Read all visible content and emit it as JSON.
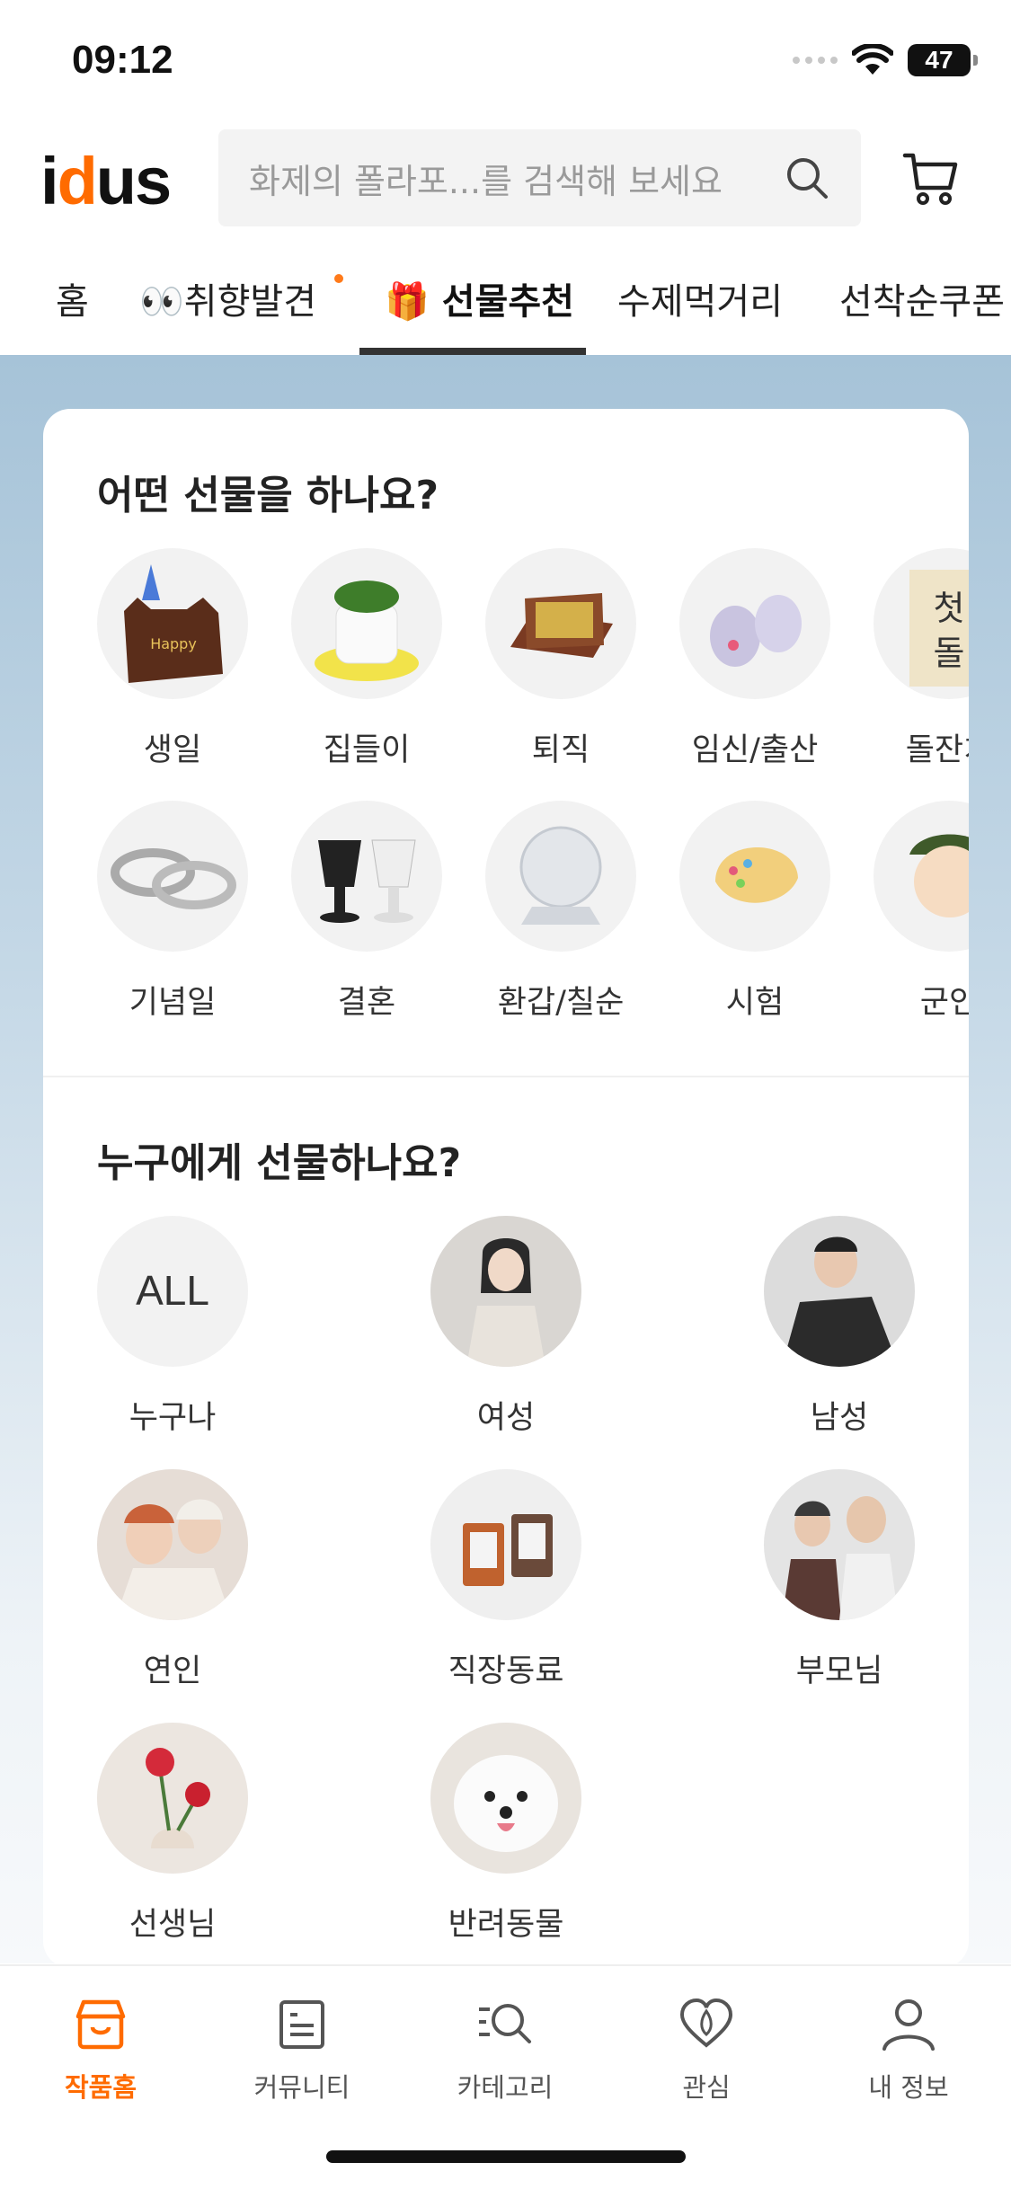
{
  "status": {
    "time": "09:12",
    "battery": "47"
  },
  "header": {
    "logo_i": "i",
    "logo_d": "d",
    "logo_us": "us",
    "search_placeholder": "화제의 폴라포...를 검색해 보세요"
  },
  "tabs": [
    {
      "label": "홈"
    },
    {
      "label": "👀취향발견"
    },
    {
      "label": "🎁 선물추천"
    },
    {
      "label": "수제먹거리"
    },
    {
      "label": "선착순쿠폰"
    }
  ],
  "occasion": {
    "title": "어떤 선물을 하나요?",
    "items": [
      {
        "label": "생일"
      },
      {
        "label": "집들이"
      },
      {
        "label": "퇴직"
      },
      {
        "label": "임신/출산"
      },
      {
        "label": "돌잔치"
      },
      {
        "label": "기념일"
      },
      {
        "label": "결혼"
      },
      {
        "label": "환갑/칠순"
      },
      {
        "label": "시험"
      },
      {
        "label": "군인"
      }
    ]
  },
  "recipient": {
    "title": "누구에게 선물하나요?",
    "all_text": "ALL",
    "items": [
      {
        "label": "누구나"
      },
      {
        "label": "여성"
      },
      {
        "label": "남성"
      },
      {
        "label": "연인"
      },
      {
        "label": "직장동료"
      },
      {
        "label": "부모님"
      },
      {
        "label": "선생님"
      },
      {
        "label": "반려동물"
      }
    ]
  },
  "bottom_nav": [
    {
      "label": "작품홈",
      "icon": "store-icon",
      "active": true
    },
    {
      "label": "커뮤니티",
      "icon": "community-icon"
    },
    {
      "label": "카테고리",
      "icon": "category-icon"
    },
    {
      "label": "관심",
      "icon": "heart-icon"
    },
    {
      "label": "내 정보",
      "icon": "user-icon"
    }
  ],
  "colors": {
    "accent": "#ff6b00",
    "sky": "#a6c3d8"
  }
}
